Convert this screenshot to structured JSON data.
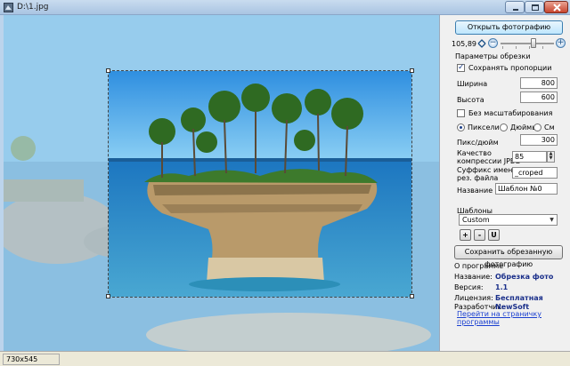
{
  "window": {
    "title": "D:\\1.jpg"
  },
  "toolbar": {
    "open_label": "Открыть фотографию",
    "zoom_value": "105,89",
    "zoom_fit_icon": "fit-icon",
    "zoom_minus": "−",
    "zoom_plus": "+"
  },
  "crop": {
    "group_title": "Параметры обрезки",
    "keep_proportions_label": "Сохранять пропорции",
    "keep_proportions": true,
    "width_label": "Ширина",
    "width_value": "800",
    "height_label": "Высота",
    "height_value": "600",
    "no_scale_label": "Без масштабирования",
    "no_scale": false,
    "units": {
      "pixels": "Пиксели",
      "inches": "Дюймы",
      "cm": "См",
      "selected": "pixels"
    },
    "dpi_label": "Пикс/дюйм",
    "dpi_value": "300",
    "jpeg_quality_label_1": "Качество",
    "jpeg_quality_label_2": "компрессии JPEG",
    "jpeg_quality_value": "85",
    "suffix_label_1": "Суффикс имени",
    "suffix_label_2": "рез. файла",
    "suffix_value": "_croped",
    "name_label": "Название",
    "name_value": "Шаблон №0"
  },
  "templates": {
    "group_title": "Шаблоны",
    "selected": "Custom",
    "add_label": "+",
    "remove_label": "-",
    "update_label": "U"
  },
  "save": {
    "label": "Сохранить обрезанную фотографию"
  },
  "about": {
    "title": "О программе",
    "name_label": "Название:",
    "name_value": "Обрезка фото",
    "version_label": "Версия:",
    "version_value": "1.1",
    "license_label": "Лицензия:",
    "license_value": "Бесплатная",
    "developer_label": "Разработчик:",
    "developer_value": "NewSoft",
    "link_label": "Перейти на страничку программы"
  },
  "status": {
    "image_size": "730x545"
  },
  "colors": {
    "sky": "#3fa9e6",
    "sea": "#1e86c8",
    "rock": "#b99a6a",
    "foliage": "#3d7a2c",
    "link": "#1a3fd0",
    "info_value": "#1a2f8a"
  }
}
